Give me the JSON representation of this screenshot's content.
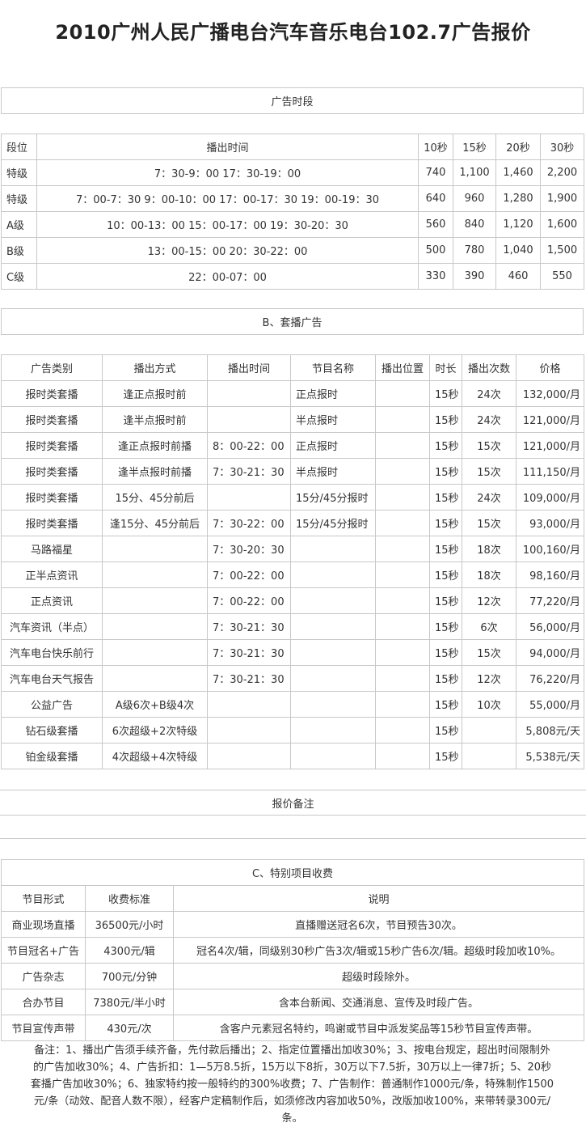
{
  "title": "2010广州人民广播电台汽车音乐电台102.7广告报价",
  "section_a": {
    "heading": "广告时段",
    "columns": [
      "段位",
      "播出时间",
      "10秒",
      "15秒",
      "20秒",
      "30秒"
    ],
    "rows": [
      [
        "特级",
        "7：30-9：00 17：30-19：00",
        "740",
        "1,100",
        "1,460",
        "2,200"
      ],
      [
        "特级",
        "7：00-7：30 9：00-10：00 17：00-17：30 19：00-19：30",
        "640",
        "960",
        "1,280",
        "1,900"
      ],
      [
        "A级",
        "10：00-13：00 15：00-17：00 19：30-20：30",
        "560",
        "840",
        "1,120",
        "1,600"
      ],
      [
        "B级",
        "13：00-15：00 20：30-22：00",
        "500",
        "780",
        "1,040",
        "1,500"
      ],
      [
        "C级",
        "22：00-07：00",
        "330",
        "390",
        "460",
        "550"
      ]
    ]
  },
  "section_b": {
    "heading": "B、套播广告",
    "columns": [
      "广告类别",
      "播出方式",
      "播出时间",
      "节目名称",
      "播出位置",
      "时长",
      "播出次数",
      "价格"
    ],
    "rows": [
      [
        "报时类套播",
        "逢正点报时前",
        "",
        "正点报时",
        "",
        "15秒",
        "24次",
        "132,000/月"
      ],
      [
        "报时类套播",
        "逢半点报时前",
        "",
        "半点报时",
        "",
        "15秒",
        "24次",
        "121,000/月"
      ],
      [
        "报时类套播",
        "逢正点报时前播",
        "8：00-22：00",
        "正点报时",
        "",
        "15秒",
        "15次",
        "121,000/月"
      ],
      [
        "报时类套播",
        "逢半点报时前播",
        "7：30-21：30",
        "半点报时",
        "",
        "15秒",
        "15次",
        "111,150/月"
      ],
      [
        "报时类套播",
        "15分、45分前后",
        "",
        "15分/45分报时",
        "",
        "15秒",
        "24次",
        "109,000/月"
      ],
      [
        "报时类套播",
        "逢15分、45分前后",
        "7：30-22：00",
        "15分/45分报时",
        "",
        "15秒",
        "15次",
        "93,000/月"
      ],
      [
        "马路福星",
        "",
        "7：30-20：30",
        "",
        "",
        "15秒",
        "18次",
        "100,160/月"
      ],
      [
        "正半点资讯",
        "",
        "7：00-22：00",
        "",
        "",
        "15秒",
        "18次",
        "98,160/月"
      ],
      [
        "正点资讯",
        "",
        "7：00-22：00",
        "",
        "",
        "15秒",
        "12次",
        "77,220/月"
      ],
      [
        "汽车资讯（半点）",
        "",
        "7：30-21：30",
        "",
        "",
        "15秒",
        "6次",
        "56,000/月"
      ],
      [
        "汽车电台快乐前行",
        "",
        "7：30-21：30",
        "",
        "",
        "15秒",
        "15次",
        "94,000/月"
      ],
      [
        "汽车电台天气报告",
        "",
        "7：30-21：30",
        "",
        "",
        "15秒",
        "12次",
        "76,220/月"
      ],
      [
        "公益广告",
        "A级6次+B级4次",
        "",
        "",
        "",
        "15秒",
        "10次",
        "55,000/月"
      ],
      [
        "钻石级套播",
        "6次超级+2次特级",
        "",
        "",
        "",
        "15秒",
        "",
        "5,808元/天"
      ],
      [
        "铂金级套播",
        "4次超级+4次特级",
        "",
        "",
        "",
        "15秒",
        "",
        "5,538元/天"
      ]
    ]
  },
  "remarks_heading": "报价备注",
  "section_c": {
    "heading": "C、特别项目收费",
    "columns": [
      "节目形式",
      "收费标准",
      "说明"
    ],
    "rows": [
      [
        "商业现场直播",
        "36500元/小时",
        "直播赠送冠名6次，节目预告30次。"
      ],
      [
        "节目冠名+广告",
        "4300元/辑",
        "冠名4次/辑，同级别30秒广告3次/辑或15秒广告6次/辑。超级时段加收10%。"
      ],
      [
        "广告杂志",
        "700元/分钟",
        "超级时段除外。"
      ],
      [
        "合办节目",
        "7380元/半小时",
        "含本台新闻、交通消息、宣传及时段广告。"
      ],
      [
        "节目宣传声带",
        "430元/次",
        "含客户元素冠名特约，鸣谢或节目中派发奖品等15秒节目宣传声带。"
      ]
    ]
  },
  "notes": [
    "备注：1、播出广告须手续齐备，先付款后播出；2、指定位置播出加收30%；3、按电台规定，超出时间限制外",
    "的广告加收30%；4、广告折扣：1—5万8.5折，15万以下8折，30万以下7.5折，30万以上一律7折；5、20秒",
    "套播广告加收30%；6、独家特约按一般特约的300%收费；7、广告制作：普通制作1000元/条，特殊制作1500",
    "元/条（动效、配音人数不限），经客户定稿制作后，如须修改内容加收50%，改版加收100%，来带转录300元/",
    "条。"
  ]
}
